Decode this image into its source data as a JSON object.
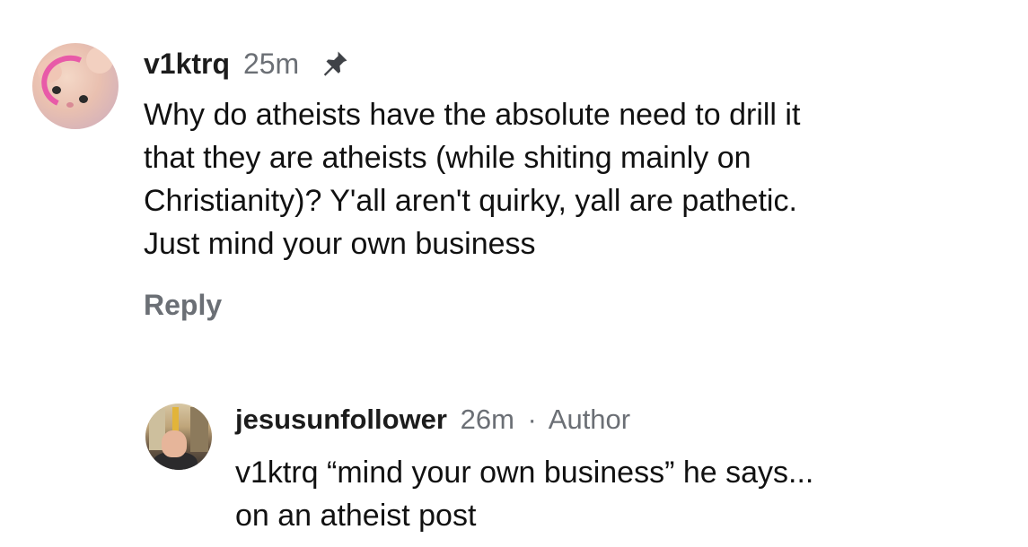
{
  "comment": {
    "username": "v1ktrq",
    "time": "25m",
    "icon": "pin-icon",
    "text": "Why do atheists have the absolute need to drill it\nthat they are atheists (while shiting mainly on\nChristianity)? Y'all aren't quirky, yall are pathetic.\nJust mind your own business",
    "reply_label": "Reply"
  },
  "reply": {
    "username": "jesusunfollower",
    "time": "26m",
    "separator": "·",
    "badge": "Author",
    "text": "v1ktrq “mind your own business” he says...\non an atheist post"
  },
  "colors": {
    "text": "#111111",
    "meta": "#6b6f75",
    "background": "#ffffff"
  }
}
